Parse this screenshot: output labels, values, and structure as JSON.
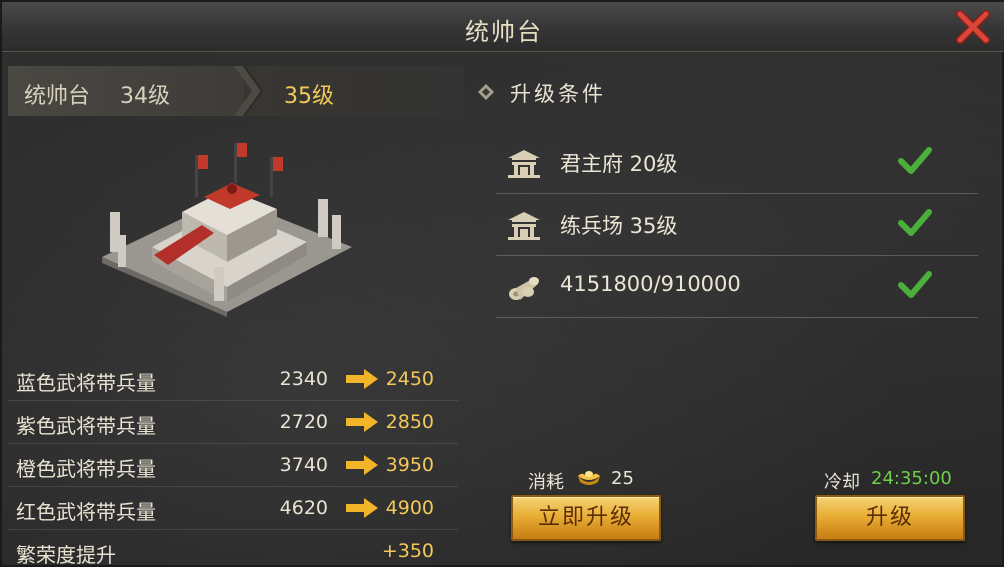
{
  "window": {
    "title": "统帅台"
  },
  "level": {
    "name": "统帅台",
    "current": "34级",
    "next": "35级"
  },
  "stats": [
    {
      "label": "蓝色武将带兵量",
      "current": "2340",
      "next": "2450"
    },
    {
      "label": "紫色武将带兵量",
      "current": "2720",
      "next": "2850"
    },
    {
      "label": "橙色武将带兵量",
      "current": "3740",
      "next": "3950"
    },
    {
      "label": "红色武将带兵量",
      "current": "4620",
      "next": "4900"
    },
    {
      "label": "繁荣度提升",
      "current": "",
      "next": "+350"
    }
  ],
  "conditions": {
    "title": "升级条件",
    "items": [
      {
        "icon": "building-icon",
        "text": "君主府 20级",
        "met": true
      },
      {
        "icon": "building-icon",
        "text": "练兵场 35级",
        "met": true
      },
      {
        "icon": "wood-icon",
        "text": "4151800/910000",
        "met": true
      }
    ]
  },
  "cost": {
    "label": "消耗",
    "icon": "gold-ingot-icon",
    "value": "25"
  },
  "cooldown": {
    "label": "冷却",
    "value": "24:35:00"
  },
  "buttons": {
    "instant": "立即升级",
    "upgrade": "升级"
  },
  "colors": {
    "accent_gold": "#f3c85a",
    "check_green": "#4caf3c",
    "timer_green": "#6fcf4a",
    "close_red": "#c0392b"
  }
}
